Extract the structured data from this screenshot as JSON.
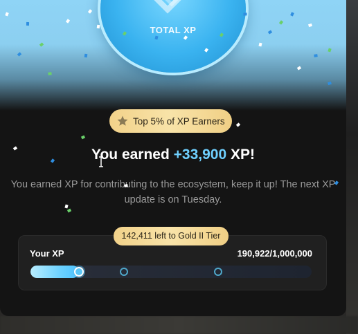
{
  "hero": {
    "medal_label": "TOTAL XP",
    "icon": "x-logo-icon"
  },
  "badge": {
    "icon": "star-icon",
    "text": "Top 5% of XP Earners"
  },
  "headline": {
    "prefix": "You earned ",
    "amount": "+33,900",
    "suffix": " XP!"
  },
  "description": "You earned XP for contributing to the ecosystem, keep it up! The next XP update is on Tuesday.",
  "progress": {
    "tier_hint": "142,411 left to Gold II Tier",
    "label": "Your XP",
    "value_text": "190,922/1,000,000",
    "current": 190922,
    "max": 1000000,
    "milestones": 3
  },
  "colors": {
    "accent": "#6fd0ff",
    "gold": "#f2d28a",
    "modal_bg": "#141414"
  }
}
